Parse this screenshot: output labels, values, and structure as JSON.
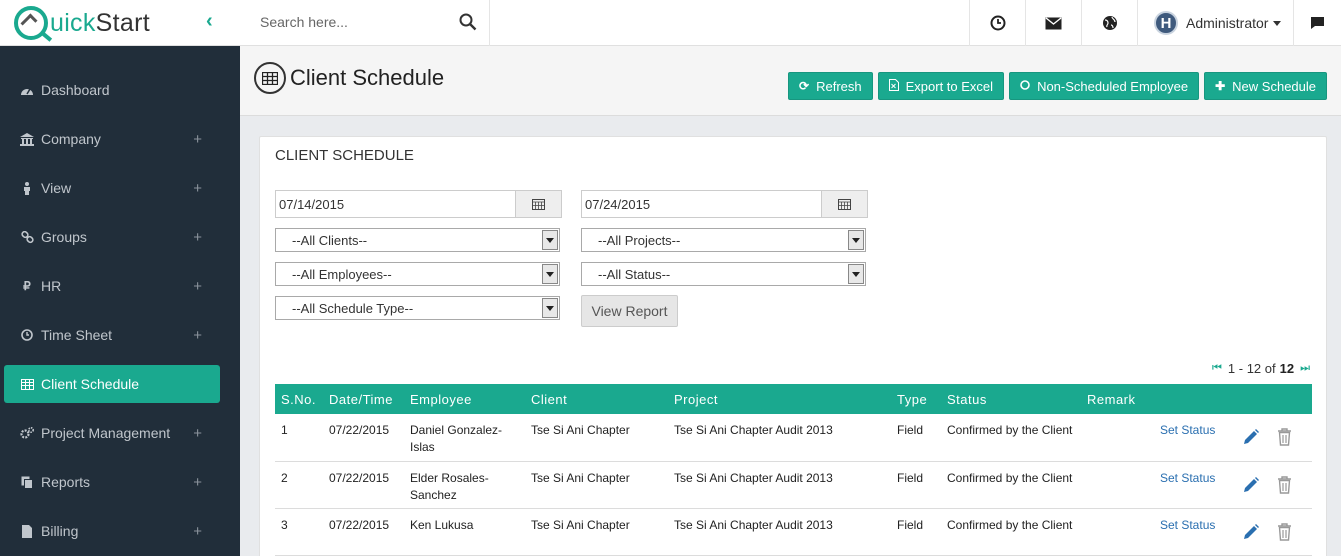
{
  "brand": {
    "logo_text_prefix": "uick",
    "logo_text_suffix": "Start",
    "collapse_glyph": "‹"
  },
  "search": {
    "placeholder": "Search here..."
  },
  "topbar": {
    "icons": [
      "clock-icon",
      "envelope-icon",
      "globe-icon",
      "chat-icon"
    ],
    "user": {
      "avatar_letter": "H",
      "name": "Administrator"
    }
  },
  "sidebar": {
    "items": [
      {
        "label": "Dashboard",
        "icon": "dashboard-icon",
        "expandable": false,
        "active": false
      },
      {
        "label": "Company",
        "icon": "bank-icon",
        "expandable": true,
        "active": false
      },
      {
        "label": "View",
        "icon": "person-icon",
        "expandable": true,
        "active": false
      },
      {
        "label": "Groups",
        "icon": "link-icon",
        "expandable": true,
        "active": false
      },
      {
        "label": "HR",
        "icon": "ruble-icon",
        "expandable": true,
        "active": false
      },
      {
        "label": "Time Sheet",
        "icon": "clock-icon",
        "expandable": true,
        "active": false
      },
      {
        "label": "Client Schedule",
        "icon": "table-icon",
        "expandable": false,
        "active": true
      },
      {
        "label": "Project Management",
        "icon": "gears-icon",
        "expandable": true,
        "active": false
      },
      {
        "label": "Reports",
        "icon": "copy-icon",
        "expandable": true,
        "active": false
      },
      {
        "label": "Billing",
        "icon": "file-icon",
        "expandable": true,
        "active": false
      }
    ],
    "plus_glyph": "+"
  },
  "page": {
    "title": "Client Schedule",
    "buttons": {
      "refresh": "Refresh",
      "export": "Export to Excel",
      "non_scheduled": "Non-Scheduled Employee",
      "new_schedule": "New Schedule"
    }
  },
  "panel": {
    "title": "CLIENT SCHEDULE",
    "filters": {
      "date_from": "07/14/2015",
      "date_to": "07/24/2015",
      "clients": "--All Clients--",
      "projects": "--All Projects--",
      "employees": "--All Employees--",
      "status": "--All Status--",
      "schedule_type": "--All Schedule Type--"
    },
    "view_report": "View Report",
    "pager": {
      "range": "1 - 12 of",
      "total": "12"
    },
    "table": {
      "headers": [
        "S.No.",
        "Date/Time",
        "Employee",
        "Client",
        "Project",
        "Type",
        "Status",
        "Remark"
      ],
      "rows": [
        {
          "sno": "1",
          "date": "07/22/2015",
          "employee": "Daniel Gonzalez-Islas",
          "client": "Tse Si Ani Chapter",
          "project": "Tse Si Ani Chapter Audit 2013",
          "type": "Field",
          "status": "Confirmed by the Client",
          "remark": "",
          "action": "Set Status"
        },
        {
          "sno": "2",
          "date": "07/22/2015",
          "employee": "Elder Rosales-Sanchez",
          "client": "Tse Si Ani Chapter",
          "project": "Tse Si Ani Chapter Audit 2013",
          "type": "Field",
          "status": "Confirmed by the Client",
          "remark": "",
          "action": "Set Status"
        },
        {
          "sno": "3",
          "date": "07/22/2015",
          "employee": "Ken Lukusa",
          "client": "Tse Si Ani Chapter",
          "project": "Tse Si Ani Chapter Audit 2013",
          "type": "Field",
          "status": "Confirmed by the Client",
          "remark": "",
          "action": "Set Status"
        }
      ]
    }
  },
  "colors": {
    "accent": "#1aa98f",
    "sidebar": "#212e3a",
    "link": "#2a6fb0"
  }
}
